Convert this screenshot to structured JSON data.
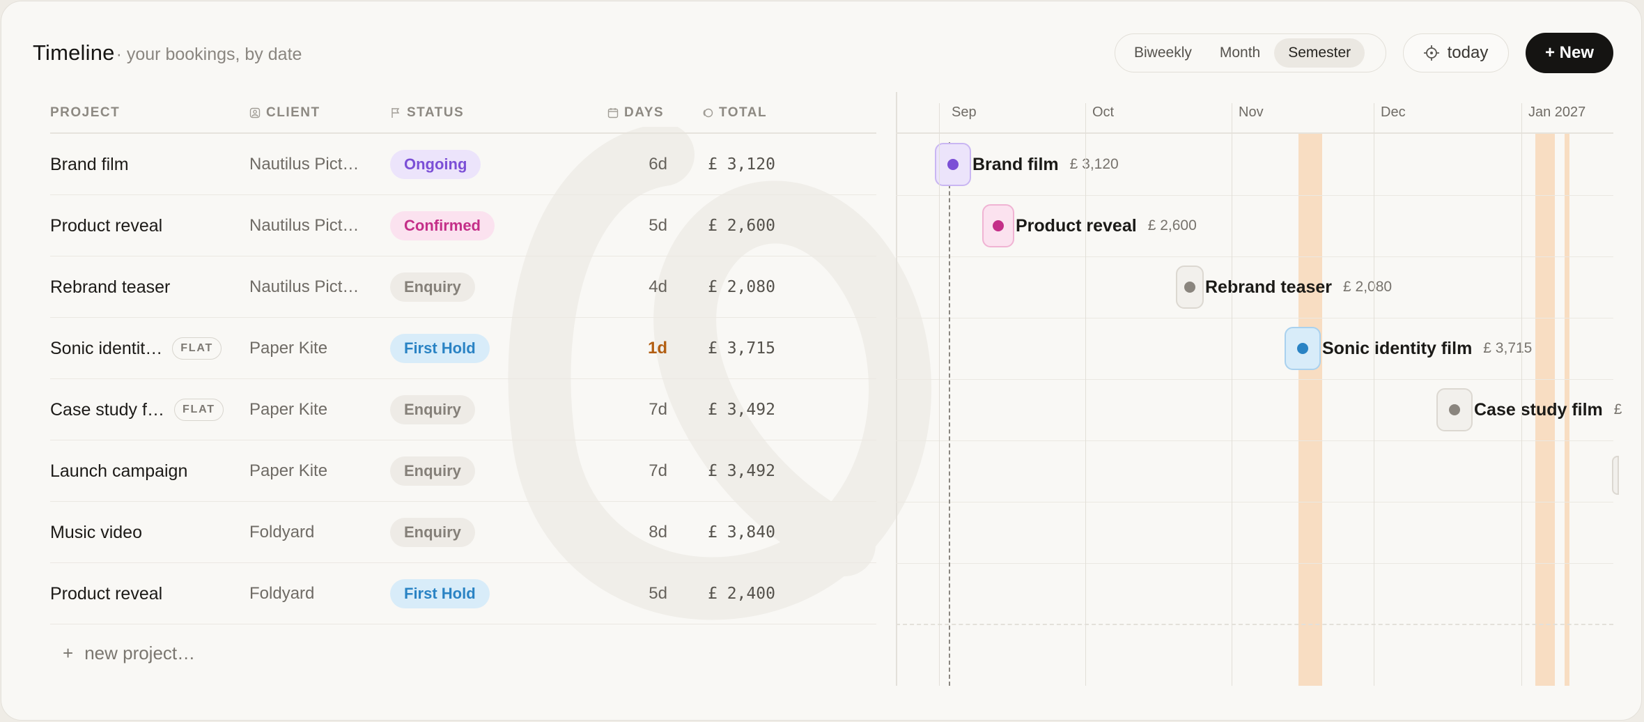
{
  "header": {
    "title": "Timeline",
    "subtitle": "· your bookings, by date",
    "views": [
      "Biweekly",
      "Month",
      "Semester"
    ],
    "active_view": "Semester",
    "today_label": "today",
    "new_label": "+ New"
  },
  "table": {
    "columns": {
      "project": "PROJECT",
      "client": "CLIENT",
      "status": "STATUS",
      "days": "DAYS",
      "total": "TOTAL"
    },
    "rows": [
      {
        "project": "Brand film",
        "flat": "",
        "client": "Nautilus Pict…",
        "status": "Ongoing",
        "status_kind": "ongoing",
        "days": "6d",
        "urgent": false,
        "total": "£ 3,120"
      },
      {
        "project": "Product reveal",
        "flat": "",
        "client": "Nautilus Pict…",
        "status": "Confirmed",
        "status_kind": "confirmed",
        "days": "5d",
        "urgent": false,
        "total": "£ 2,600"
      },
      {
        "project": "Rebrand teaser",
        "flat": "",
        "client": "Nautilus Pict…",
        "status": "Enquiry",
        "status_kind": "enquiry",
        "days": "4d",
        "urgent": false,
        "total": "£ 2,080"
      },
      {
        "project": "Sonic identit…",
        "flat": "FLAT",
        "client": "Paper Kite",
        "status": "First Hold",
        "status_kind": "firsthold",
        "days": "1d",
        "urgent": true,
        "total": "£ 3,715"
      },
      {
        "project": "Case study f…",
        "flat": "FLAT",
        "client": "Paper Kite",
        "status": "Enquiry",
        "status_kind": "enquiry",
        "days": "7d",
        "urgent": false,
        "total": "£ 3,492"
      },
      {
        "project": "Launch campaign",
        "flat": "",
        "client": "Paper Kite",
        "status": "Enquiry",
        "status_kind": "enquiry",
        "days": "7d",
        "urgent": false,
        "total": "£ 3,492"
      },
      {
        "project": "Music video",
        "flat": "",
        "client": "Foldyard",
        "status": "Enquiry",
        "status_kind": "enquiry",
        "days": "8d",
        "urgent": false,
        "total": "£ 3,840"
      },
      {
        "project": "Product reveal",
        "flat": "",
        "client": "Foldyard",
        "status": "First Hold",
        "status_kind": "firsthold",
        "days": "5d",
        "urgent": false,
        "total": "£ 2,400"
      }
    ],
    "new_project_label": "new project…"
  },
  "timeline": {
    "months": [
      "Sep",
      "Oct",
      "Nov",
      "Dec",
      "Jan 2027"
    ],
    "bars": [
      {
        "label": "Brand film",
        "amount": "£ 3,120",
        "color": "#7b4fd6",
        "chip_bg": "#ece4fb",
        "chip_border": "#c9b6f2"
      },
      {
        "label": "Product reveal",
        "amount": "£ 2,600",
        "color": "#c42e88",
        "chip_bg": "#fbe2ef",
        "chip_border": "#f0b3d3"
      },
      {
        "label": "Rebrand teaser",
        "amount": "£ 2,080",
        "color": "#8a857e",
        "chip_bg": "#f2f0ec",
        "chip_border": "#dcd8d1"
      },
      {
        "label": "Sonic identity film",
        "amount": "£ 3,715",
        "color": "#2a83c4",
        "chip_bg": "#d8ecf9",
        "chip_border": "#a9d1ee"
      },
      {
        "label": "Case study film",
        "amount": "£",
        "color": "#8a857e",
        "chip_bg": "#f2f0ec",
        "chip_border": "#dcd8d1"
      }
    ]
  }
}
